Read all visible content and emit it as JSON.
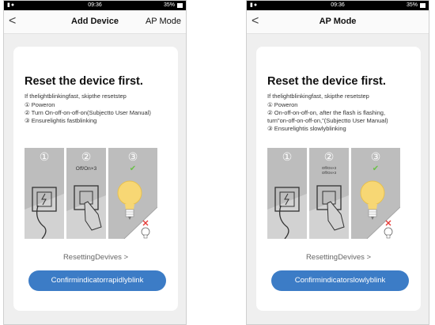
{
  "left": {
    "status": {
      "time": "09:36",
      "battery": "35%"
    },
    "nav": {
      "back": "<",
      "title": "Add Device",
      "action": "AP Mode"
    },
    "card": {
      "title": "Reset the device first.",
      "intro": "If thelightblinkingfast, skipthe resetstep",
      "steps": [
        "① Poweron",
        "② Turn On-off-on-off-on(Subjectto User Manual)",
        "③ Ensurelightis fastblinking"
      ],
      "panels": {
        "p1": "①",
        "p2": "②",
        "p3": "③",
        "caption2": "Off/On×3",
        "check": "✔"
      },
      "link": "ResettingDevives >",
      "button": "Confirmindicatorrapidlyblink"
    }
  },
  "right": {
    "status": {
      "time": "09:36",
      "battery": "35%"
    },
    "nav": {
      "back": "<",
      "title": "AP Mode"
    },
    "card": {
      "title": "Reset the device first.",
      "intro": "If thelightblinkingfast, skipthe resetstep",
      "steps": [
        "① Poweron",
        "② On-off-on-off-on, after the flash is flashing,",
        "turn\"on-off-on-off-on,\"(Subjectto User Manual)",
        "③ Ensurelightis slowlyblinking"
      ],
      "panels": {
        "p1": "①",
        "p2": "②",
        "p3": "③",
        "caption2a": "Off/On×3",
        "caption2b": "Off/On×3",
        "check": "✔"
      },
      "link": "ResettingDevives >",
      "button": "Confirmindicatorslowlyblink"
    }
  },
  "icons": [
    "signal-icon",
    "wifi-icon",
    "battery-icon",
    "back-icon",
    "plug-socket-icon",
    "switch-hand-icon",
    "lightbulb-icon",
    "check-icon",
    "cross-icon"
  ],
  "colors": {
    "accent": "#3c7cc6",
    "check": "#6cc04a",
    "cross": "#e53935",
    "bulb": "#f7d774"
  }
}
